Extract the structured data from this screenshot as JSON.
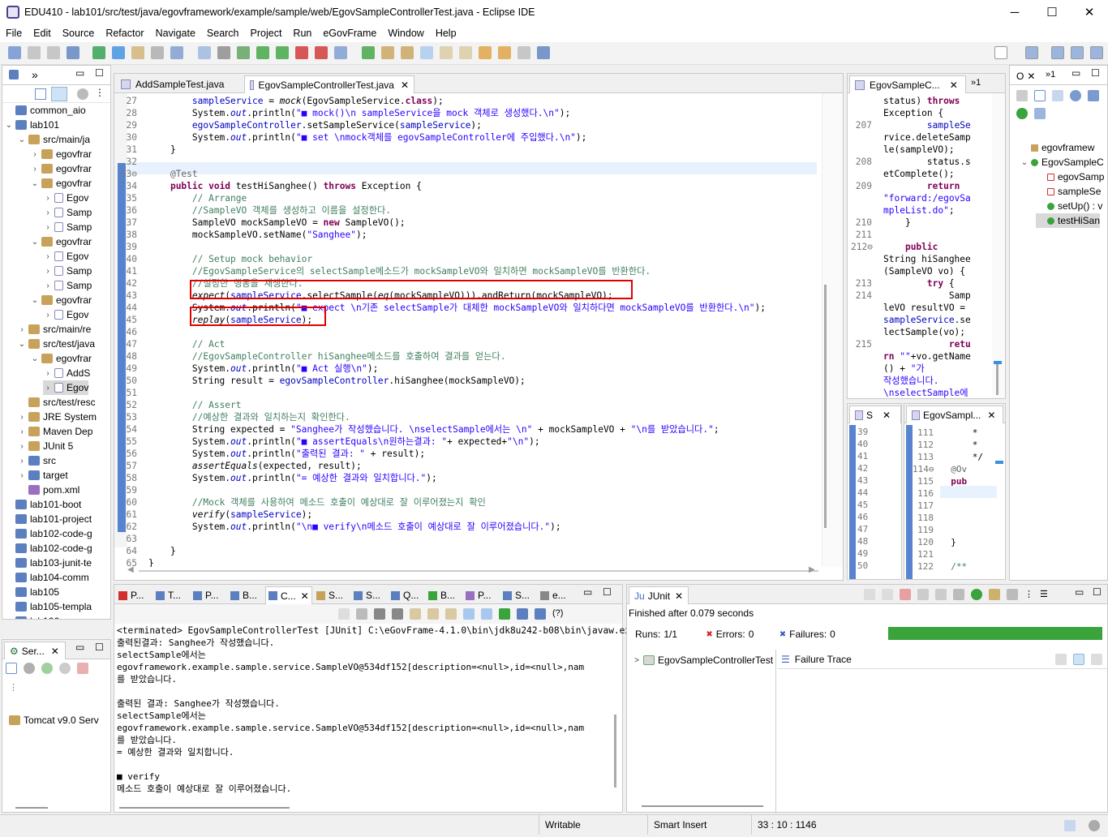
{
  "window": {
    "title": "EDU410 - lab101/src/test/java/egovframework/example/sample/web/EgovSampleControllerTest.java - Eclipse IDE",
    "minimize": "─",
    "maximize": "☐",
    "close": "✕"
  },
  "menu": [
    "File",
    "Edit",
    "Source",
    "Refactor",
    "Navigate",
    "Search",
    "Project",
    "Run",
    "eGovFrame",
    "Window",
    "Help"
  ],
  "explorer": {
    "rows": [
      {
        "indent": 0,
        "tw": "",
        "label": "common_aio",
        "icon": "folder"
      },
      {
        "indent": 0,
        "tw": "v",
        "label": "lab101",
        "icon": "folder"
      },
      {
        "indent": 1,
        "tw": "v",
        "label": "src/main/ja",
        "icon": "srcfolder"
      },
      {
        "indent": 2,
        "tw": ">",
        "label": "egovfrar",
        "icon": "package"
      },
      {
        "indent": 2,
        "tw": ">",
        "label": "egovfrar",
        "icon": "package"
      },
      {
        "indent": 2,
        "tw": "v",
        "label": "egovfrar",
        "icon": "package"
      },
      {
        "indent": 3,
        "tw": ">",
        "label": "Egov",
        "icon": "java"
      },
      {
        "indent": 3,
        "tw": ">",
        "label": "Samp",
        "icon": "java"
      },
      {
        "indent": 3,
        "tw": ">",
        "label": "Samp",
        "icon": "java"
      },
      {
        "indent": 2,
        "tw": "v",
        "label": "egovfrar",
        "icon": "package"
      },
      {
        "indent": 3,
        "tw": ">",
        "label": "Egov",
        "icon": "java"
      },
      {
        "indent": 3,
        "tw": ">",
        "label": "Samp",
        "icon": "java"
      },
      {
        "indent": 3,
        "tw": ">",
        "label": "Samp",
        "icon": "java"
      },
      {
        "indent": 2,
        "tw": "v",
        "label": "egovfrar",
        "icon": "package"
      },
      {
        "indent": 3,
        "tw": ">",
        "label": "Egov",
        "icon": "java"
      },
      {
        "indent": 1,
        "tw": ">",
        "label": "src/main/re",
        "icon": "srcfolder"
      },
      {
        "indent": 1,
        "tw": "v",
        "label": "src/test/java",
        "icon": "srcfolder"
      },
      {
        "indent": 2,
        "tw": "v",
        "label": "egovfrar",
        "icon": "package"
      },
      {
        "indent": 3,
        "tw": ">",
        "label": "AddS",
        "icon": "java"
      },
      {
        "indent": 3,
        "tw": ">",
        "label": "Egov",
        "icon": "java",
        "selected": true
      },
      {
        "indent": 1,
        "tw": "",
        "label": "src/test/resc",
        "icon": "srcfolder"
      },
      {
        "indent": 1,
        "tw": ">",
        "label": "JRE System",
        "icon": "lib"
      },
      {
        "indent": 1,
        "tw": ">",
        "label": "Maven Dep",
        "icon": "lib"
      },
      {
        "indent": 1,
        "tw": ">",
        "label": "JUnit 5",
        "icon": "lib"
      },
      {
        "indent": 1,
        "tw": ">",
        "label": "src",
        "icon": "folder"
      },
      {
        "indent": 1,
        "tw": ">",
        "label": "target",
        "icon": "folder"
      },
      {
        "indent": 1,
        "tw": "",
        "label": "pom.xml",
        "icon": "xml"
      },
      {
        "indent": 0,
        "tw": "",
        "label": "lab101-boot",
        "icon": "folder"
      },
      {
        "indent": 0,
        "tw": "",
        "label": "lab101-project",
        "icon": "folder"
      },
      {
        "indent": 0,
        "tw": "",
        "label": "lab102-code-g",
        "icon": "folder"
      },
      {
        "indent": 0,
        "tw": "",
        "label": "lab102-code-g",
        "icon": "folder"
      },
      {
        "indent": 0,
        "tw": "",
        "label": "lab103-junit-te",
        "icon": "folder"
      },
      {
        "indent": 0,
        "tw": "",
        "label": "lab104-comm",
        "icon": "folder"
      },
      {
        "indent": 0,
        "tw": "",
        "label": "lab105",
        "icon": "folder"
      },
      {
        "indent": 0,
        "tw": "",
        "label": "lab105-templa",
        "icon": "folder"
      },
      {
        "indent": 0,
        "tw": "",
        "label": "lab106",
        "icon": "folder"
      }
    ]
  },
  "servers": {
    "tab": "Ser...",
    "item": "Tomcat v9.0 Serv"
  },
  "editor": {
    "tabs": [
      "AddSampleTest.java",
      "EgovSampleControllerTest.java"
    ],
    "lines": [
      {
        "n": "27",
        "h": "        <span class=\"fld\">sampleService</span> = <span class=\"it\">mock</span>(EgovSampleService.<span class=\"kw\">class</span>);"
      },
      {
        "n": "28",
        "h": "        System.<span class=\"fld it\">out</span>.println(<span class=\"st\">\"■ mock()\\n sampleService을 mock 객체로 생성했다.\\n\"</span>);"
      },
      {
        "n": "29",
        "h": "        <span class=\"fld\">egovSampleController</span>.setSampleService(<span class=\"fld\">sampleService</span>);"
      },
      {
        "n": "30",
        "h": "        System.<span class=\"fld it\">out</span>.println(<span class=\"st\">\"■ set \\nmock객체를 egovSampleController에 주입했다.\\n\"</span>);"
      },
      {
        "n": "31",
        "h": "    }"
      },
      {
        "n": "32",
        "h": ""
      },
      {
        "n": "33⊖",
        "h": "    <span class=\"ann\">@Test</span>"
      },
      {
        "n": "34",
        "h": "    <span class=\"kw\">public void</span> testHiSanghee() <span class=\"kw\">throws</span> Exception {"
      },
      {
        "n": "35",
        "h": "        <span class=\"cm\">// Arrange</span>"
      },
      {
        "n": "36",
        "h": "        <span class=\"cm\">//SampleVO 객체를 생성하고 이름을 설정한다.</span>"
      },
      {
        "n": "37",
        "h": "        SampleVO mockSampleVO = <span class=\"kw\">new</span> SampleVO();"
      },
      {
        "n": "38",
        "h": "        mockSampleVO.setName(<span class=\"st\">\"Sanghee\"</span>);"
      },
      {
        "n": "39",
        "h": ""
      },
      {
        "n": "40",
        "h": "        <span class=\"cm\">// Setup mock behavior</span>"
      },
      {
        "n": "41",
        "h": "        <span class=\"cm\">//EgovSampleService의 selectSample메소드가 mockSampleVO와 일치하면 mockSampleVO를 반환한다.</span>"
      },
      {
        "n": "42",
        "h": "        <span class=\"cm\">//설정한 행동을 재생한다.</span>"
      },
      {
        "n": "43",
        "h": "        <span class=\"it\">expect</span>(<span class=\"fld\">sampleService</span>.selectSample(<span class=\"it\">eq</span>(mockSampleVO))).andReturn(mockSampleVO);"
      },
      {
        "n": "44",
        "h": "        System.<span class=\"fld it\">out</span>.println(<span class=\"st\">\"■ expect \\n기존 selectSample가 대체한 mockSampleVO와 일치하다면 mockSampleVO를 반환한다.\\n\"</span>);"
      },
      {
        "n": "45",
        "h": "        <span class=\"it\">replay</span>(<span class=\"fld\">sampleService</span>);"
      },
      {
        "n": "46",
        "h": ""
      },
      {
        "n": "47",
        "h": "        <span class=\"cm\">// Act</span>"
      },
      {
        "n": "48",
        "h": "        <span class=\"cm\">//EgovSampleController hiSanghee메소드를 호출하여 결과를 얻는다.</span>"
      },
      {
        "n": "49",
        "h": "        System.<span class=\"fld it\">out</span>.println(<span class=\"st\">\"■ Act 실행\\n\"</span>);"
      },
      {
        "n": "50",
        "h": "        String result = <span class=\"fld\">egovSampleController</span>.hiSanghee(mockSampleVO);"
      },
      {
        "n": "51",
        "h": ""
      },
      {
        "n": "52",
        "h": "        <span class=\"cm\">// Assert</span>"
      },
      {
        "n": "53",
        "h": "        <span class=\"cm\">//예상한 결과와 일치하는지 확인한다.</span>"
      },
      {
        "n": "54",
        "h": "        String expected = <span class=\"st\">\"Sanghee가 작성했습니다. \\nselectSample에서는 \\n\"</span> + mockSampleVO + <span class=\"st\">\"\\n를 받았습니다.\"</span>;"
      },
      {
        "n": "55",
        "h": "        System.<span class=\"fld it\">out</span>.println(<span class=\"st\">\"■ assertEquals\\n원하는결과: \"</span>+ expected+<span class=\"st\">\"\\n\"</span>);"
      },
      {
        "n": "56",
        "h": "        System.<span class=\"fld it\">out</span>.println(<span class=\"st\">\"출력된 결과: \"</span> + result);"
      },
      {
        "n": "57",
        "h": "        <span class=\"it\">assertEquals</span>(expected, result);"
      },
      {
        "n": "58",
        "h": "        System.<span class=\"fld it\">out</span>.println(<span class=\"st\">\"= 예상한 결과와 일치합니다.\"</span>);"
      },
      {
        "n": "59",
        "h": ""
      },
      {
        "n": "60",
        "h": "        <span class=\"cm\">//Mock 객체를 사용하여 메소드 호출이 예상대로 잘 이루어졌는지 확인</span>"
      },
      {
        "n": "61",
        "h": "        <span class=\"it\">verify</span>(<span class=\"fld\">sampleService</span>);"
      },
      {
        "n": "62",
        "h": "        System.<span class=\"fld it\">out</span>.println(<span class=\"st\">\"\\n■ verify\\n메소드 호출이 예상대로 잘 이루어졌습니다.\"</span>);"
      },
      {
        "n": "63",
        "h": ""
      },
      {
        "n": "64",
        "h": "    }"
      },
      {
        "n": "65",
        "h": "}"
      }
    ]
  },
  "side_editor": {
    "tab": "EgovSampleC...",
    "overflow": "»1",
    "lines": [
      {
        "n": "",
        "h": "status) <span class=\"kw\">throws</span>"
      },
      {
        "n": "",
        "h": "Exception {"
      },
      {
        "n": "207",
        "h": "        <span class=\"fld\">sampleSe</span>"
      },
      {
        "n": "",
        "h": "rvice.deleteSamp"
      },
      {
        "n": "",
        "h": "le(sampleVO);"
      },
      {
        "n": "208",
        "h": "        status.s"
      },
      {
        "n": "",
        "h": "etComplete();"
      },
      {
        "n": "209",
        "h": "        <span class=\"kw\">return</span>"
      },
      {
        "n": "",
        "h": "<span class=\"st\">\"forward:/egovSa</span>"
      },
      {
        "n": "",
        "h": "<span class=\"st\">mpleList.do\"</span>;"
      },
      {
        "n": "210",
        "h": "    }"
      },
      {
        "n": "211",
        "h": ""
      },
      {
        "n": "212⊖",
        "h": "    <span class=\"kw\">public</span>"
      },
      {
        "n": "",
        "h": "String hiSanghee"
      },
      {
        "n": "",
        "h": "(SampleVO vo) {"
      },
      {
        "n": "213",
        "h": "        <span class=\"kw\">try</span> {"
      },
      {
        "n": "214",
        "h": "            Samp"
      },
      {
        "n": "",
        "h": "leVO resultVO ="
      },
      {
        "n": "",
        "h": "<span class=\"fld\">sampleService</span>.se"
      },
      {
        "n": "",
        "h": "lectSample(vo);"
      },
      {
        "n": "215",
        "h": "            <span class=\"kw\">retu</span>"
      },
      {
        "n": "",
        "h": "<span class=\"kw\">rn</span> <span class=\"st\">\"\"</span>+vo.getName"
      },
      {
        "n": "",
        "h": "() + <span class=\"st\">\"가</span>"
      },
      {
        "n": "",
        "h": "<span class=\"st\">작성했습니다.</span>"
      },
      {
        "n": "",
        "h": "<span class=\"st\">\\nselectSample에</span>"
      }
    ]
  },
  "small1": {
    "tab": "S",
    "lines": [
      "39",
      "40",
      "41",
      "42",
      "43",
      "44",
      "45",
      "46",
      "47",
      "48",
      "49",
      "50"
    ]
  },
  "small2": {
    "tab": "EgovSampl...",
    "lines": [
      {
        "n": "111",
        "h": "      *"
      },
      {
        "n": "112",
        "h": "      *"
      },
      {
        "n": "113",
        "h": "      */"
      },
      {
        "n": "114⊖",
        "h": "  <span class=\"ann\">@Ov</span>"
      },
      {
        "n": "115",
        "h": "  <span class=\"kw\">pub</span>"
      },
      {
        "n": "116",
        "h": ""
      },
      {
        "n": "117",
        "h": ""
      },
      {
        "n": "118",
        "h": ""
      },
      {
        "n": "119",
        "h": ""
      },
      {
        "n": "120",
        "h": "  }"
      },
      {
        "n": "121",
        "h": ""
      },
      {
        "n": "122",
        "h": "  <span class=\"cm\">/**</span>"
      }
    ]
  },
  "outline": {
    "tab": "O",
    "overflow": "»1",
    "items": [
      {
        "label": "egovframew",
        "icon": "package",
        "indent": 0
      },
      {
        "label": "EgovSampleC",
        "icon": "class",
        "indent": 0
      },
      {
        "label": "egovSamp",
        "icon": "field",
        "indent": 1
      },
      {
        "label": "sampleSe",
        "icon": "field",
        "indent": 1
      },
      {
        "label": "setUp() : v",
        "icon": "method",
        "indent": 1
      },
      {
        "label": "testHiSan",
        "icon": "method",
        "indent": 1,
        "selected": true
      }
    ]
  },
  "console": {
    "tabs": [
      "P...",
      "T...",
      "P...",
      "B...",
      "C...",
      "S...",
      "S...",
      "Q...",
      "B...",
      "P...",
      "S...",
      "e..."
    ],
    "help": "(?)",
    "header": "<terminated> EgovSampleControllerTest [JUnit] C:\\eGovFrame-4.1.0\\bin\\jdk8u242-b08\\bin\\javaw.exe  (2023. 1",
    "lines": [
      "출력된결과: Sanghee가 작성했습니다.",
      "selectSample에서는",
      "egovframework.example.sample.service.SampleVO@534df152[description=<null>,id=<null>,nam",
      "를 받았습니다.",
      "",
      "출력된 결과: Sanghee가 작성했습니다.",
      "selectSample에서는",
      "egovframework.example.sample.service.SampleVO@534df152[description=<null>,id=<null>,nam",
      "를 받았습니다.",
      "= 예상한 결과와 일치합니다.",
      "",
      "■ verify",
      "메소드 호출이 예상대로 잘 이루어졌습니다."
    ]
  },
  "junit": {
    "tab": "JUnit",
    "finished": "Finished after 0.079 seconds",
    "runs_label": "Runs:",
    "runs": "1/1",
    "errors_label": "Errors:",
    "errors": "0",
    "failures_label": "Failures:",
    "failures": "0",
    "progress": 1.0,
    "bar_color": "#3ba33b",
    "test": "EgovSampleControllerTest",
    "trace": "Failure Trace"
  },
  "status": {
    "writable": "Writable",
    "mode": "Smart Insert",
    "position": "33 : 10 : 1146"
  }
}
